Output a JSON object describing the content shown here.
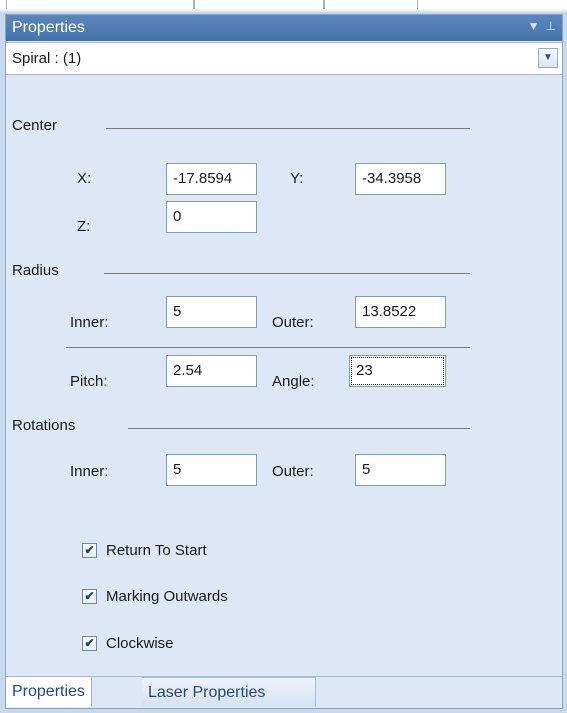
{
  "panel": {
    "title": "Properties",
    "object_selector": "Spiral : (1)"
  },
  "sections": {
    "center": "Center",
    "radius": "Radius",
    "rotations": "Rotations"
  },
  "center": {
    "x_label": "X:",
    "x_value": "-17.8594",
    "y_label": "Y:",
    "y_value": "-34.3958",
    "z_label": "Z:",
    "z_value": "0"
  },
  "radius": {
    "inner_label": "Inner:",
    "inner_value": "5",
    "outer_label": "Outer:",
    "outer_value": "13.8522",
    "pitch_label": "Pitch:",
    "pitch_value": "2.54",
    "angle_label": "Angle:",
    "angle_value": "23"
  },
  "rotations": {
    "inner_label": "Inner:",
    "inner_value": "5",
    "outer_label": "Outer:",
    "outer_value": "5"
  },
  "options": [
    {
      "label": "Return To Start",
      "checked": true
    },
    {
      "label": "Marking Outwards",
      "checked": true
    },
    {
      "label": "Clockwise",
      "checked": true
    }
  ],
  "tabs": [
    "Properties",
    "Laser Properties"
  ]
}
